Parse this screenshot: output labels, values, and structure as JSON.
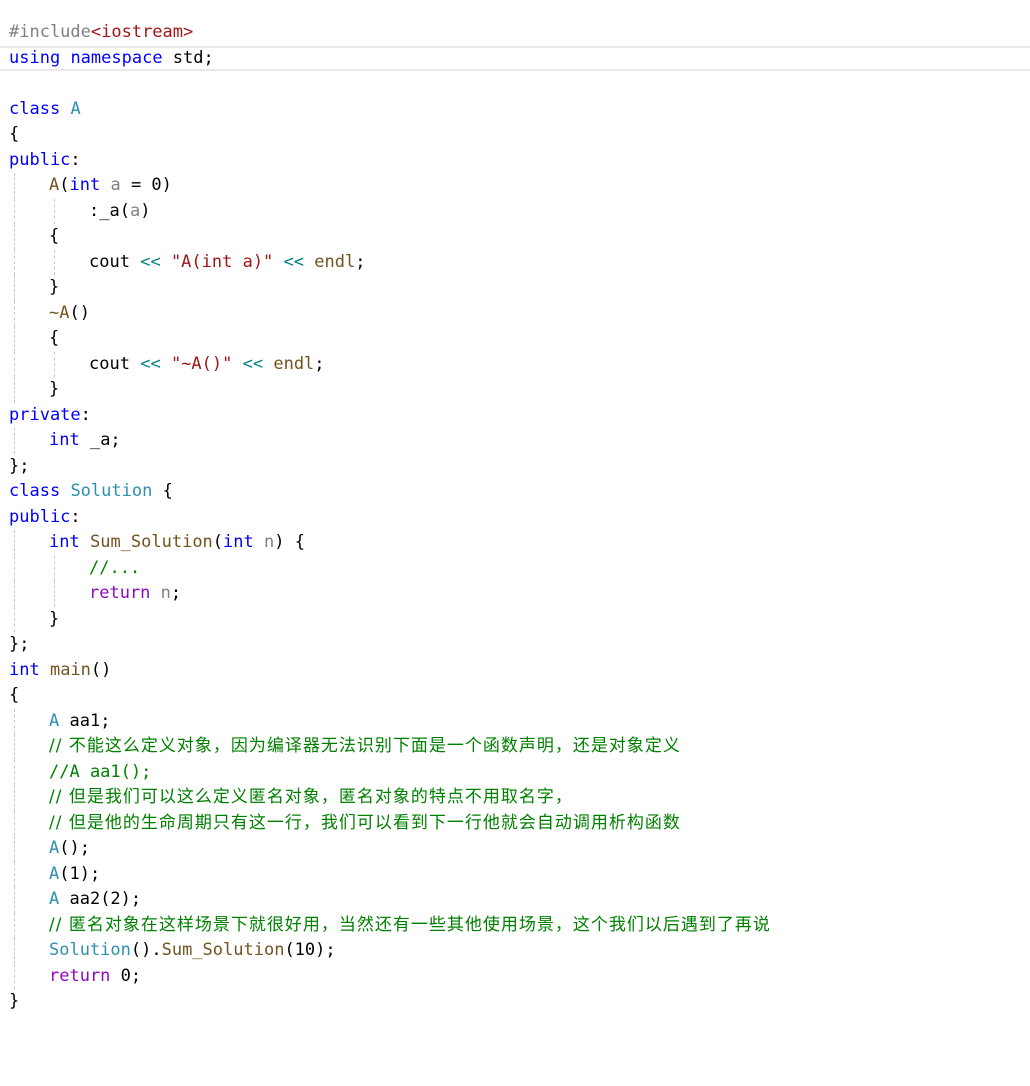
{
  "editor": {
    "lines": [
      {
        "indent": 0,
        "current": false,
        "guides": [],
        "tokens": [
          {
            "t": "#include",
            "c": "pp"
          },
          {
            "t": "<iostream>",
            "c": "inc"
          }
        ]
      },
      {
        "indent": 0,
        "current": true,
        "guides": [],
        "tokens": [
          {
            "t": "using",
            "c": "kw"
          },
          {
            "t": " ",
            "c": "plain"
          },
          {
            "t": "namespace",
            "c": "kw"
          },
          {
            "t": " std;",
            "c": "plain"
          }
        ]
      },
      {
        "indent": 0,
        "current": false,
        "guides": [],
        "tokens": []
      },
      {
        "indent": 0,
        "current": false,
        "guides": [],
        "tokens": [
          {
            "t": "class",
            "c": "kw"
          },
          {
            "t": " ",
            "c": "plain"
          },
          {
            "t": "A",
            "c": "cls"
          }
        ]
      },
      {
        "indent": 0,
        "current": false,
        "guides": [],
        "tokens": [
          {
            "t": "{",
            "c": "plain"
          }
        ]
      },
      {
        "indent": 0,
        "current": false,
        "guides": [],
        "tokens": [
          {
            "t": "public",
            "c": "kw"
          },
          {
            "t": ":",
            "c": "plain"
          }
        ]
      },
      {
        "indent": 1,
        "current": false,
        "guides": [
          1
        ],
        "tokens": [
          {
            "t": "A",
            "c": "fn"
          },
          {
            "t": "(",
            "c": "plain"
          },
          {
            "t": "int",
            "c": "kw"
          },
          {
            "t": " ",
            "c": "plain"
          },
          {
            "t": "a",
            "c": "par"
          },
          {
            "t": " = 0)",
            "c": "plain"
          }
        ]
      },
      {
        "indent": 2,
        "current": false,
        "guides": [
          1,
          2
        ],
        "tokens": [
          {
            "t": ":_a(",
            "c": "plain"
          },
          {
            "t": "a",
            "c": "par"
          },
          {
            "t": ")",
            "c": "plain"
          }
        ]
      },
      {
        "indent": 1,
        "current": false,
        "guides": [
          1
        ],
        "tokens": [
          {
            "t": "{",
            "c": "plain"
          }
        ]
      },
      {
        "indent": 2,
        "current": false,
        "guides": [
          1,
          2
        ],
        "tokens": [
          {
            "t": "cout",
            "c": "plain"
          },
          {
            "t": " ",
            "c": "plain"
          },
          {
            "t": "<<",
            "c": "op"
          },
          {
            "t": " ",
            "c": "plain"
          },
          {
            "t": "\"A(int a)\"",
            "c": "str"
          },
          {
            "t": " ",
            "c": "plain"
          },
          {
            "t": "<<",
            "c": "op"
          },
          {
            "t": " ",
            "c": "plain"
          },
          {
            "t": "endl",
            "c": "fn"
          },
          {
            "t": ";",
            "c": "plain"
          }
        ]
      },
      {
        "indent": 1,
        "current": false,
        "guides": [
          1
        ],
        "tokens": [
          {
            "t": "}",
            "c": "plain"
          }
        ]
      },
      {
        "indent": 1,
        "current": false,
        "guides": [
          1
        ],
        "tokens": [
          {
            "t": "~A",
            "c": "fn"
          },
          {
            "t": "()",
            "c": "plain"
          }
        ]
      },
      {
        "indent": 1,
        "current": false,
        "guides": [
          1
        ],
        "tokens": [
          {
            "t": "{",
            "c": "plain"
          }
        ]
      },
      {
        "indent": 2,
        "current": false,
        "guides": [
          1,
          2
        ],
        "tokens": [
          {
            "t": "cout",
            "c": "plain"
          },
          {
            "t": " ",
            "c": "plain"
          },
          {
            "t": "<<",
            "c": "op"
          },
          {
            "t": " ",
            "c": "plain"
          },
          {
            "t": "\"~A()\"",
            "c": "str"
          },
          {
            "t": " ",
            "c": "plain"
          },
          {
            "t": "<<",
            "c": "op"
          },
          {
            "t": " ",
            "c": "plain"
          },
          {
            "t": "endl",
            "c": "fn"
          },
          {
            "t": ";",
            "c": "plain"
          }
        ]
      },
      {
        "indent": 1,
        "current": false,
        "guides": [
          1
        ],
        "tokens": [
          {
            "t": "}",
            "c": "plain"
          }
        ]
      },
      {
        "indent": 0,
        "current": false,
        "guides": [],
        "tokens": [
          {
            "t": "private",
            "c": "kw"
          },
          {
            "t": ":",
            "c": "plain"
          }
        ]
      },
      {
        "indent": 1,
        "current": false,
        "guides": [
          1
        ],
        "tokens": [
          {
            "t": "int",
            "c": "kw"
          },
          {
            "t": " _a;",
            "c": "plain"
          }
        ]
      },
      {
        "indent": 0,
        "current": false,
        "guides": [],
        "tokens": [
          {
            "t": "};",
            "c": "plain"
          }
        ]
      },
      {
        "indent": 0,
        "current": false,
        "guides": [],
        "tokens": [
          {
            "t": "class",
            "c": "kw"
          },
          {
            "t": " ",
            "c": "plain"
          },
          {
            "t": "Solution",
            "c": "cls"
          },
          {
            "t": " {",
            "c": "plain"
          }
        ]
      },
      {
        "indent": 0,
        "current": false,
        "guides": [],
        "tokens": [
          {
            "t": "public",
            "c": "kw"
          },
          {
            "t": ":",
            "c": "plain"
          }
        ]
      },
      {
        "indent": 1,
        "current": false,
        "guides": [
          1
        ],
        "tokens": [
          {
            "t": "int",
            "c": "kw"
          },
          {
            "t": " ",
            "c": "plain"
          },
          {
            "t": "Sum_Solution",
            "c": "fn"
          },
          {
            "t": "(",
            "c": "plain"
          },
          {
            "t": "int",
            "c": "kw"
          },
          {
            "t": " ",
            "c": "plain"
          },
          {
            "t": "n",
            "c": "par"
          },
          {
            "t": ") {",
            "c": "plain"
          }
        ]
      },
      {
        "indent": 2,
        "current": false,
        "guides": [
          1,
          2
        ],
        "tokens": [
          {
            "t": "//...",
            "c": "cmt"
          }
        ]
      },
      {
        "indent": 2,
        "current": false,
        "guides": [
          1,
          2
        ],
        "tokens": [
          {
            "t": "return",
            "c": "ctl"
          },
          {
            "t": " ",
            "c": "plain"
          },
          {
            "t": "n",
            "c": "par"
          },
          {
            "t": ";",
            "c": "plain"
          }
        ]
      },
      {
        "indent": 1,
        "current": false,
        "guides": [
          1
        ],
        "tokens": [
          {
            "t": "}",
            "c": "plain"
          }
        ]
      },
      {
        "indent": 0,
        "current": false,
        "guides": [],
        "tokens": [
          {
            "t": "};",
            "c": "plain"
          }
        ]
      },
      {
        "indent": 0,
        "current": false,
        "guides": [],
        "tokens": [
          {
            "t": "int",
            "c": "kw"
          },
          {
            "t": " ",
            "c": "plain"
          },
          {
            "t": "main",
            "c": "fn"
          },
          {
            "t": "()",
            "c": "plain"
          }
        ]
      },
      {
        "indent": 0,
        "current": false,
        "guides": [],
        "tokens": [
          {
            "t": "{",
            "c": "plain"
          }
        ]
      },
      {
        "indent": 1,
        "current": false,
        "guides": [
          1
        ],
        "tokens": [
          {
            "t": "A",
            "c": "cls"
          },
          {
            "t": " aa1;",
            "c": "plain"
          }
        ]
      },
      {
        "indent": 1,
        "current": false,
        "guides": [
          1
        ],
        "tokens": [
          {
            "t": "// 不能这么定义对象，因为编译器无法识别下面是一个函数声明，还是对象定义",
            "c": "cmt-zh"
          }
        ]
      },
      {
        "indent": 1,
        "current": false,
        "guides": [
          1
        ],
        "tokens": [
          {
            "t": "//A aa1();",
            "c": "cmt"
          }
        ]
      },
      {
        "indent": 1,
        "current": false,
        "guides": [
          1
        ],
        "tokens": [
          {
            "t": "// 但是我们可以这么定义匿名对象，匿名对象的特点不用取名字，",
            "c": "cmt-zh"
          }
        ]
      },
      {
        "indent": 1,
        "current": false,
        "guides": [
          1
        ],
        "tokens": [
          {
            "t": "// 但是他的生命周期只有这一行，我们可以看到下一行他就会自动调用析构函数",
            "c": "cmt-zh"
          }
        ]
      },
      {
        "indent": 1,
        "current": false,
        "guides": [
          1
        ],
        "tokens": [
          {
            "t": "A",
            "c": "cls"
          },
          {
            "t": "();",
            "c": "plain"
          }
        ]
      },
      {
        "indent": 1,
        "current": false,
        "guides": [
          1
        ],
        "tokens": [
          {
            "t": "A",
            "c": "cls"
          },
          {
            "t": "(1);",
            "c": "plain"
          }
        ]
      },
      {
        "indent": 1,
        "current": false,
        "guides": [
          1
        ],
        "tokens": [
          {
            "t": "A",
            "c": "cls"
          },
          {
            "t": " aa2(2);",
            "c": "plain"
          }
        ]
      },
      {
        "indent": 1,
        "current": false,
        "guides": [
          1
        ],
        "tokens": [
          {
            "t": "// 匿名对象在这样场景下就很好用，当然还有一些其他使用场景，这个我们以后遇到了再说",
            "c": "cmt-zh"
          }
        ]
      },
      {
        "indent": 1,
        "current": false,
        "guides": [
          1
        ],
        "tokens": [
          {
            "t": "Solution",
            "c": "cls"
          },
          {
            "t": "().",
            "c": "plain"
          },
          {
            "t": "Sum_Solution",
            "c": "fn"
          },
          {
            "t": "(10);",
            "c": "plain"
          }
        ]
      },
      {
        "indent": 1,
        "current": false,
        "guides": [
          1
        ],
        "tokens": [
          {
            "t": "return",
            "c": "ctl"
          },
          {
            "t": " 0;",
            "c": "plain"
          }
        ]
      },
      {
        "indent": 0,
        "current": false,
        "guides": [],
        "tokens": [
          {
            "t": "}",
            "c": "plain"
          }
        ]
      }
    ]
  }
}
